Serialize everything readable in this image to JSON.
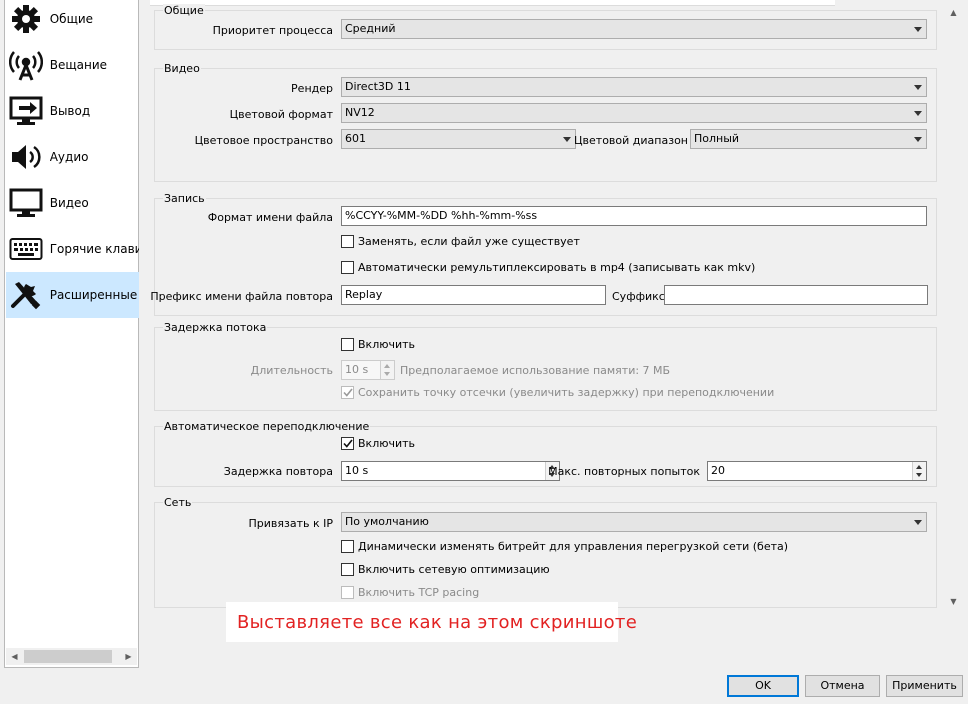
{
  "sidebar": {
    "items": [
      {
        "label": "Общие",
        "icon": "gear-icon"
      },
      {
        "label": "Вещание",
        "icon": "broadcast-icon"
      },
      {
        "label": "Вывод",
        "icon": "output-icon"
      },
      {
        "label": "Аудио",
        "icon": "speaker-icon"
      },
      {
        "label": "Видео",
        "icon": "monitor-icon"
      },
      {
        "label": "Горячие клавиши",
        "icon": "keyboard-icon"
      },
      {
        "label": "Расширенные",
        "icon": "tools-icon"
      }
    ],
    "active_index": 6
  },
  "general": {
    "title": "Общие",
    "priority_label": "Приоритет процесса",
    "priority_value": "Средний"
  },
  "video": {
    "title": "Видео",
    "renderer_label": "Рендер",
    "renderer_value": "Direct3D 11",
    "color_format_label": "Цветовой формат",
    "color_format_value": "NV12",
    "color_space_label": "Цветовое пространство",
    "color_space_value": "601",
    "color_range_label": "Цветовой диапазон",
    "color_range_value": "Полный"
  },
  "recording": {
    "title": "Запись",
    "filename_format_label": "Формат имени файла",
    "filename_format_value": "%CCYY-%MM-%DD %hh-%mm-%ss",
    "overwrite_label": "Заменять, если файл уже существует",
    "overwrite_checked": false,
    "remux_label": "Автоматически ремультиплексировать в mp4 (записывать как mkv)",
    "remux_checked": false,
    "replay_prefix_label": "Префикс имени файла повтора",
    "replay_prefix_value": "Replay",
    "suffix_label": "Суффикс",
    "suffix_value": ""
  },
  "stream_delay": {
    "title": "Задержка потока",
    "enable_label": "Включить",
    "enable_checked": false,
    "duration_label": "Длительность",
    "duration_value": "10 s",
    "memory_note": "Предполагаемое использование памяти: 7 МБ",
    "preserve_label": "Сохранить точку отсечки (увеличить задержку) при переподключении",
    "preserve_checked": true
  },
  "reconnect": {
    "title": "Автоматическое переподключение",
    "enable_label": "Включить",
    "enable_checked": true,
    "retry_delay_label": "Задержка повтора",
    "retry_delay_value": "10 s",
    "max_retries_label": "Макс. повторных попыток",
    "max_retries_value": "20"
  },
  "network": {
    "title": "Сеть",
    "bind_ip_label": "Привязать к IP",
    "bind_ip_value": "По умолчанию",
    "dynamic_bitrate_label": "Динамически изменять битрейт для управления перегрузкой сети (бета)",
    "dynamic_bitrate_checked": false,
    "net_opt_label": "Включить сетевую оптимизацию",
    "net_opt_checked": false,
    "tcp_pacing_label": "Включить TCP pacing",
    "tcp_pacing_checked": false
  },
  "annotation": {
    "text": "Выставляете все как на этом скриншоте",
    "color": "#e22222"
  },
  "buttons": {
    "ok": "OK",
    "cancel": "Отмена",
    "apply": "Применить"
  },
  "colors": {
    "accent": "#0078d7",
    "selection": "#cce8ff"
  }
}
